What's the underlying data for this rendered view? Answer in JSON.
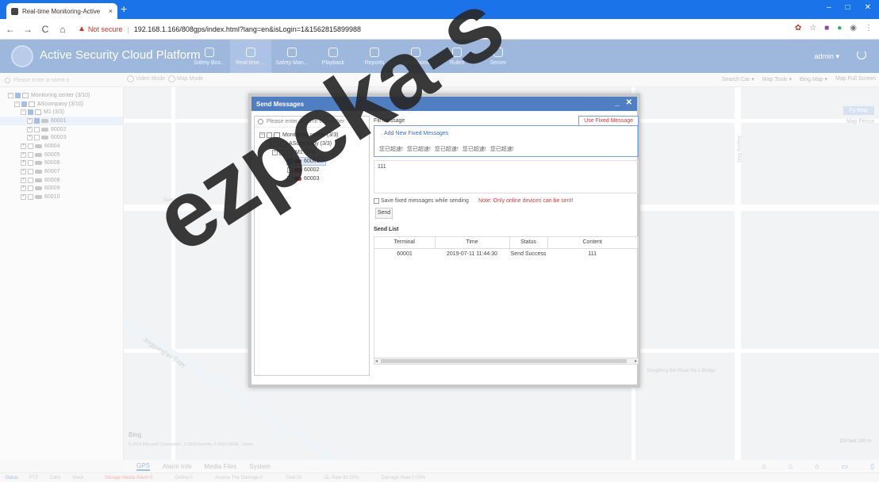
{
  "browser": {
    "tab_title": "Real-time Monitoring-Active",
    "tab_close": "×",
    "new_tab": "+",
    "min": "–",
    "max": "□",
    "close": "✕",
    "back": "←",
    "forward": "→",
    "reload": "C",
    "home": "⌂",
    "not_secure": "Not secure",
    "separator": "|",
    "url": "192.168.1.166/808gps/index.html?lang=en&isLogin=1&1562815899988"
  },
  "app": {
    "title": "Active Security Cloud Platform",
    "nav": [
      {
        "label": "Safety Box...",
        "active": false
      },
      {
        "label": "Real-time ...",
        "active": true
      },
      {
        "label": "Safety Man...",
        "active": false
      },
      {
        "label": "Playback",
        "active": false
      },
      {
        "label": "Reports",
        "active": false
      },
      {
        "label": "Operations",
        "active": false
      },
      {
        "label": "Rules",
        "active": false
      },
      {
        "label": "Server",
        "active": false
      }
    ],
    "user": "admin ▾"
  },
  "toolbar": {
    "search_placeholder": "Please enter a name o",
    "video_mode": "Video Mode",
    "map_mode": "Map Mode",
    "search_car": "Search Car ▾",
    "map_tools": "Map Tools ▾",
    "bing_map": "Bing Map ▾",
    "map_full_screen": "Map Full Screen"
  },
  "left_tree": [
    {
      "label": "Monitoring center (3/10)",
      "indent": 0,
      "icon": "monitor",
      "selected": false
    },
    {
      "label": "AScompany (3/10)",
      "indent": 1,
      "icon": "list",
      "selected": false
    },
    {
      "label": "M1 (3/3)",
      "indent": 2,
      "icon": "person",
      "selected": false
    },
    {
      "label": "60001",
      "indent": 3,
      "icon": "car",
      "selected": true
    },
    {
      "label": "60002",
      "indent": 3,
      "icon": "car",
      "selected": false
    },
    {
      "label": "60003",
      "indent": 3,
      "icon": "car",
      "selected": false
    },
    {
      "label": "60004",
      "indent": 2,
      "icon": "car",
      "selected": false
    },
    {
      "label": "60005",
      "indent": 2,
      "icon": "car",
      "selected": false
    },
    {
      "label": "60006",
      "indent": 2,
      "icon": "car",
      "selected": false
    },
    {
      "label": "60007",
      "indent": 2,
      "icon": "car",
      "selected": false
    },
    {
      "label": "60008",
      "indent": 2,
      "icon": "car",
      "selected": false
    },
    {
      "label": "60009",
      "indent": 2,
      "icon": "car",
      "selected": false
    },
    {
      "label": "60010",
      "indent": 2,
      "icon": "car",
      "selected": false
    }
  ],
  "map": {
    "labels": {
      "fy": "Fy Map",
      "fence": "Map Fence",
      "songning": "Songning Blvd",
      "jinggang": "Jinggang'ao Expy",
      "dongfeng": "Dongfeng Bei Road No.1 Bridge",
      "jingang": "Jingang Blvd",
      "bing": "Bing",
      "copyright": "© 2019 Microsoft Corporation · © 2019 NavInfo, © 2019 HERE · Terms",
      "scale": "200 feet 100 m"
    }
  },
  "dialog": {
    "title": "Send Messages",
    "minimize": "_",
    "close": "✕",
    "search_placeholder": "Please enter a name or number",
    "tree": [
      {
        "label": "Monitoring center (3/3)",
        "indent": 0,
        "icon": "monitor",
        "checked": false,
        "selected": false
      },
      {
        "label": "AScompany (3/3)",
        "indent": 1,
        "icon": "list",
        "checked": false,
        "selected": false
      },
      {
        "label": "M1 (3/3)",
        "indent": 2,
        "icon": "person",
        "checked": false,
        "selected": false
      },
      {
        "label": "60001",
        "indent": 3,
        "icon": "car",
        "checked": true,
        "selected": true
      },
      {
        "label": "60002",
        "indent": 3,
        "icon": "car",
        "checked": false,
        "selected": false
      },
      {
        "label": "60003",
        "indent": 3,
        "icon": "car",
        "checked": false,
        "selected": false
      }
    ],
    "fill_message": "Fill Message",
    "use_fixed": "Use Fixed Message",
    "add_new_fixed": "Add New Fixed Messages",
    "fixed_messages": [
      "您已超速!",
      "您已超速!",
      "您已超速!",
      "您已超速!",
      "您已超速!"
    ],
    "message_value": "111",
    "save_fixed": "Save fixed messages while sending",
    "note": "Note: Only online devices can be sent!",
    "send": "Send",
    "send_list": "Send List",
    "columns": [
      "Terminal",
      "Time",
      "Status",
      "Content"
    ],
    "rows": [
      [
        "60001",
        "2019-07-11 11:44:30",
        "Send Success",
        "111"
      ]
    ]
  },
  "bottom": {
    "tabs": [
      "GPS",
      "Alarm Info",
      "Media Files",
      "System"
    ],
    "left_tabs": [
      "Status",
      "PTZ",
      "Color",
      "Voice"
    ],
    "status": [
      "Storage Media Alarm:0",
      "Online:0",
      "Assess The Damage:0",
      "Total:10",
      "OL Rate:30.00%",
      "Damage Rate:0.00%"
    ]
  },
  "watermark": "ezpeka-s",
  "colors": {
    "header": "#4f7ec2",
    "accent": "#3b6fc4",
    "alert": "#e53935"
  }
}
